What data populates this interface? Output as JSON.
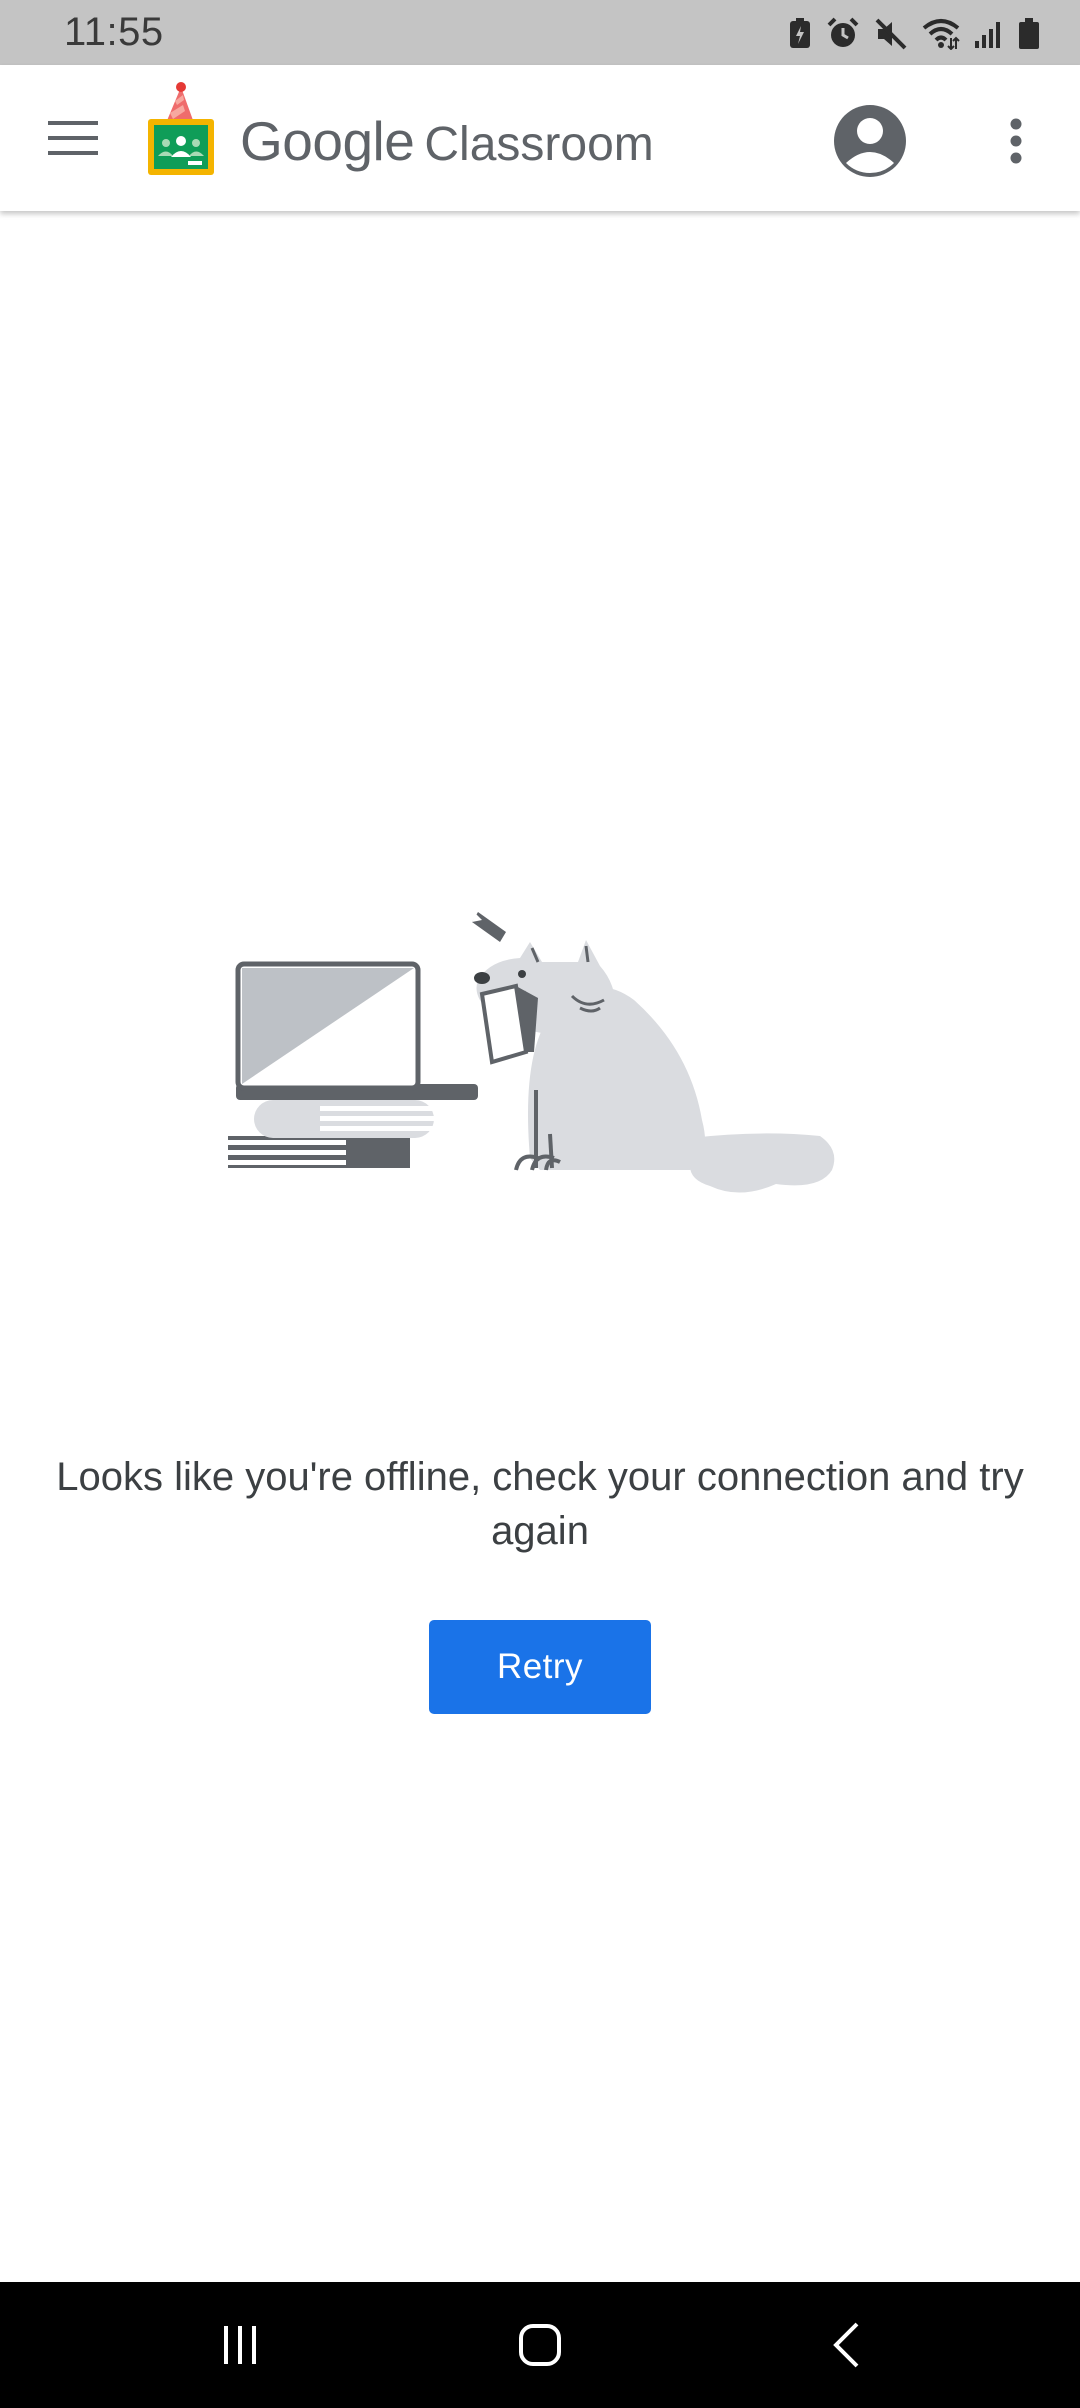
{
  "status_bar": {
    "time": "11:55",
    "icons": [
      "battery-saver-icon",
      "alarm-icon",
      "mute-icon",
      "wifi-icon",
      "signal-icon",
      "battery-icon"
    ]
  },
  "app_bar": {
    "brand_google": "Google",
    "brand_classroom": "Classroom",
    "menu_icon": "menu-icon",
    "account_icon": "account-circle-icon",
    "more_icon": "more-vert-icon"
  },
  "main": {
    "message": "Looks like you're offline, check your connection and try again",
    "retry_label": "Retry"
  },
  "nav_bar": {
    "icons": [
      "recent-apps-icon",
      "home-icon",
      "back-icon"
    ]
  },
  "colors": {
    "accent": "#1a73e8",
    "status_bar_bg": "#c4c4c4",
    "text_primary": "#3c4043",
    "brand_text": "#5f6368",
    "nav_bar_bg": "#000000"
  }
}
